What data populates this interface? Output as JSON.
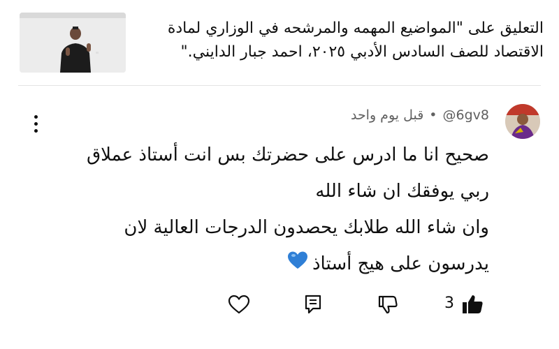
{
  "video": {
    "title_line1": "التعليق على \"المواضيع المهمه والمرشحه في الوزاري لمادة",
    "title_line2": "الاقتصاد للصف السادس الأدبي ٢٠٢٥، احمد جبار الدايني.\""
  },
  "comment": {
    "author": "@6gv8",
    "separator": "•",
    "time": "قبل يوم واحد",
    "lines": [
      "صحيح انا ما ادرس على حضرتك بس انت أستاذ عملاق",
      "ربي يوفقك ان شاء الله",
      "وان شاء الله طلابك يحصدون الدرجات العالية لان",
      "يدرسون على هيج أستاذ"
    ],
    "like_count": "3"
  },
  "icons": {
    "like": "thumbs-up-filled-icon",
    "dislike": "thumbs-down-icon",
    "reply": "comment-reply-icon",
    "heart": "heart-outline-icon",
    "more": "more-vertical-icon",
    "emoji": "blue-heart-emoji"
  },
  "colors": {
    "text": "#0f0f0f",
    "meta": "#606060",
    "divider": "#e3e3e3",
    "emoji_blue": "#2f7fd6"
  }
}
